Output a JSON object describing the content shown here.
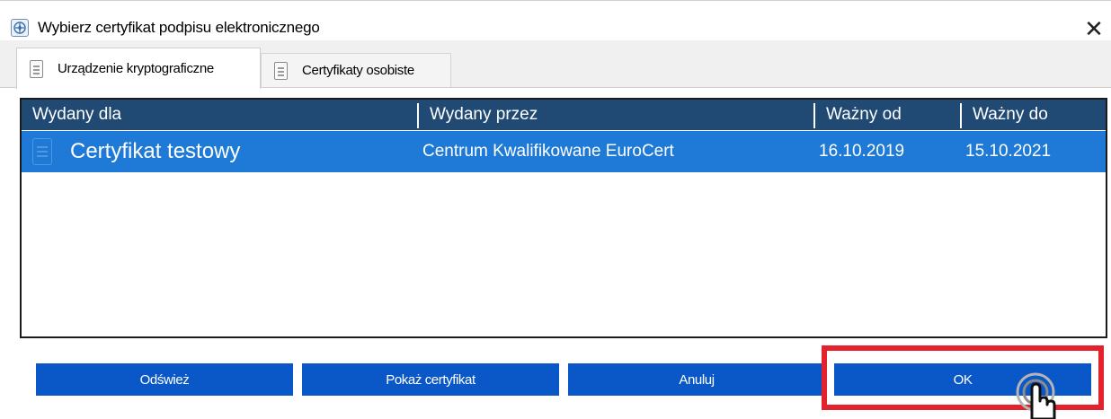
{
  "window": {
    "title": "Wybierz certyfikat podpisu elektronicznego",
    "close_glyph": "✕"
  },
  "tabs": [
    {
      "label": "Urządzenie kryptograficzne",
      "active": true,
      "icon": "device-icon"
    },
    {
      "label": "Certyfikaty osobiste",
      "active": false,
      "icon": "certificate-icon"
    }
  ],
  "table": {
    "columns": [
      "Wydany dla",
      "Wydany przez",
      "Ważny od",
      "Ważny do"
    ],
    "rows": [
      {
        "issued_to": "Certyfikat testowy",
        "issued_by": "Centrum Kwalifikowane EuroCert",
        "valid_from": "16.10.2019",
        "valid_to": "15.10.2021",
        "selected": true
      }
    ]
  },
  "buttons": {
    "refresh": "Odśwież",
    "show_certificate": "Pokaż certyfikat",
    "cancel": "Anuluj",
    "ok": "OK"
  },
  "colors": {
    "header_bg": "#204a73",
    "selected_row": "#1e7ad6",
    "button_bg": "#0a58c8",
    "highlight": "#e3222d"
  }
}
